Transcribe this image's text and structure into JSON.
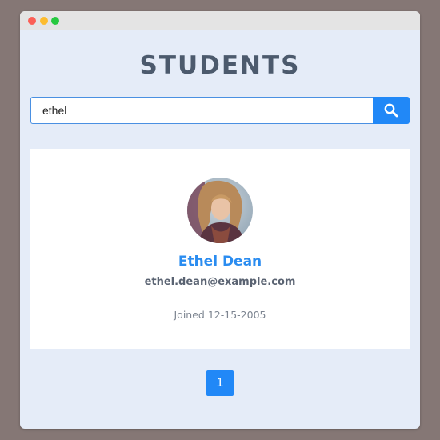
{
  "window": {
    "controls": [
      "close",
      "minimize",
      "maximize"
    ]
  },
  "page": {
    "title": "STUDENTS"
  },
  "search": {
    "value": "ethel",
    "button_icon": "search-icon"
  },
  "results": [
    {
      "name": "Ethel Dean",
      "email": "ethel.dean@example.com",
      "joined": "Joined 12-15-2005",
      "avatar_icon": "student-photo"
    }
  ],
  "pagination": {
    "pages": [
      "1"
    ],
    "current": "1"
  },
  "colors": {
    "accent": "#2188f7",
    "name": "#2a8cf0",
    "title": "#4c5a6d",
    "background": "#e5ecf8",
    "backdrop": "#857775"
  }
}
